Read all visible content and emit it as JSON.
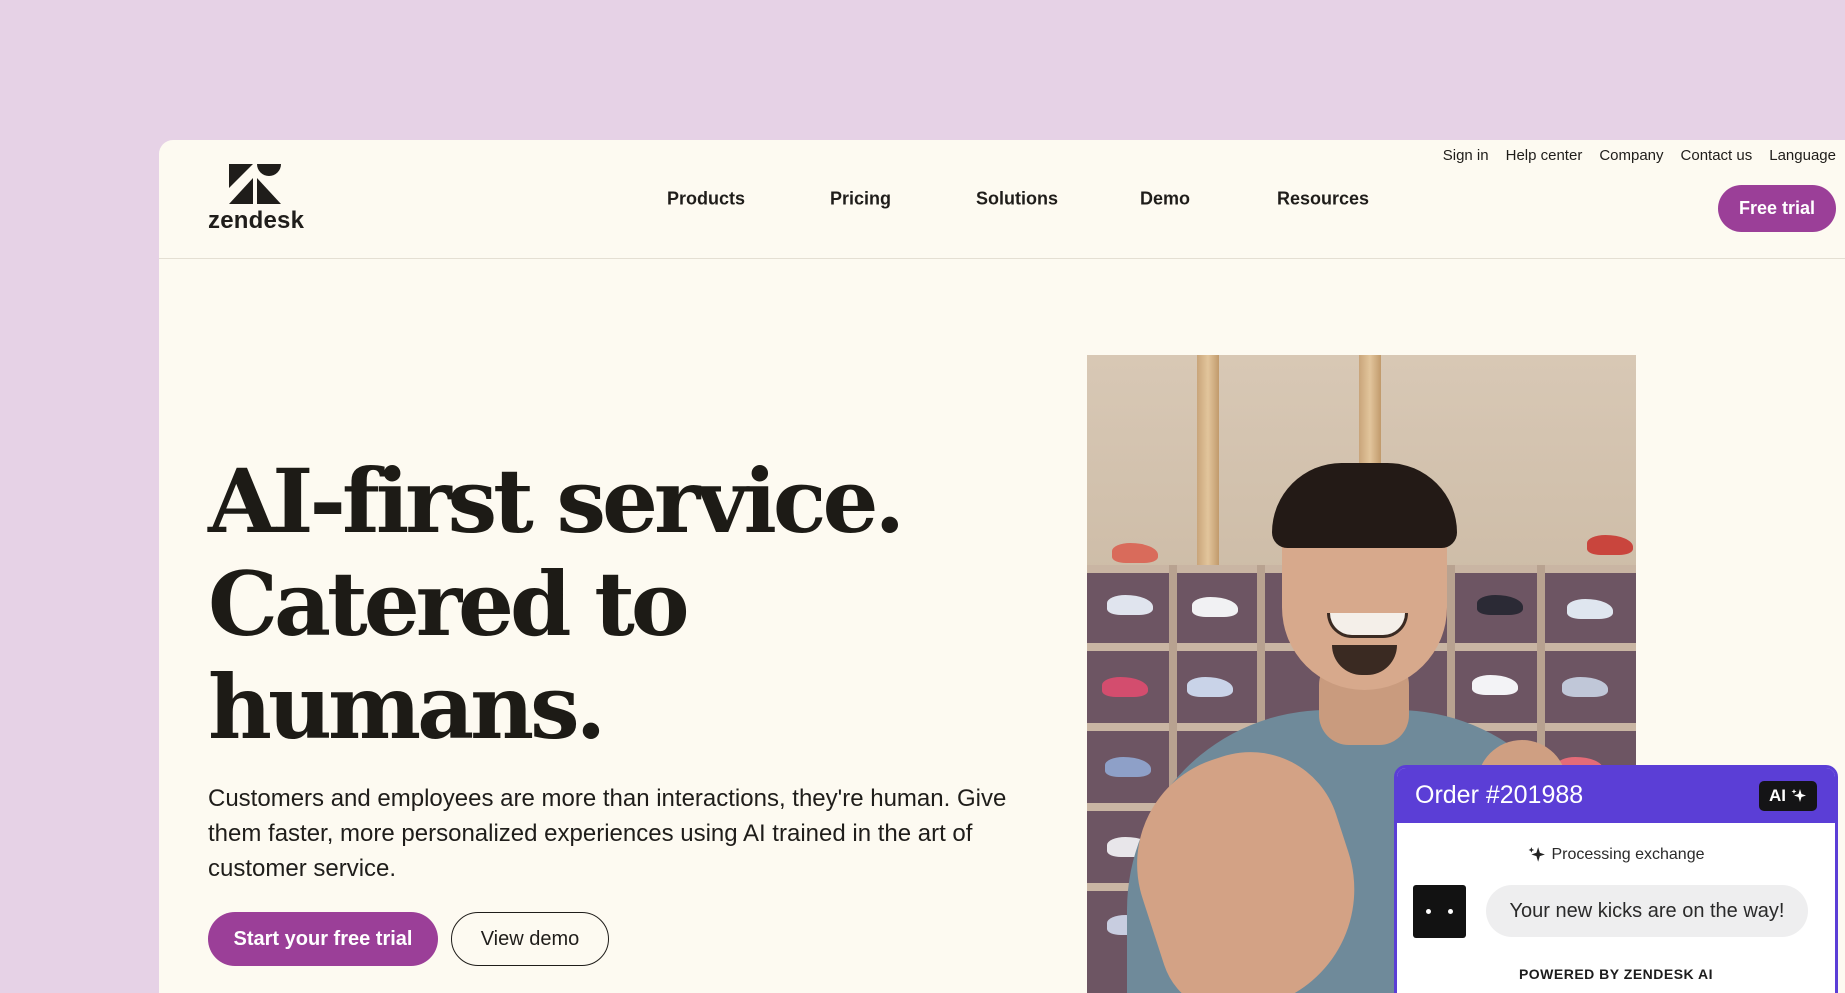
{
  "utility_nav": {
    "sign_in": "Sign in",
    "help_center": "Help center",
    "company": "Company",
    "contact_us": "Contact us",
    "language": "Language"
  },
  "brand": {
    "name": "zendesk"
  },
  "nav": {
    "products": "Products",
    "pricing": "Pricing",
    "solutions": "Solutions",
    "demo": "Demo",
    "resources": "Resources",
    "free_trial": "Free trial"
  },
  "hero": {
    "headline_lines": [
      "AI-first service.",
      "Catered to",
      "humans."
    ],
    "subcopy": "Customers and employees are more than interactions, they're human. Give them faster, more personalized experiences using AI trained in the art of customer service.",
    "cta_primary": "Start your free trial",
    "cta_secondary": "View demo"
  },
  "order_card": {
    "title": "Order #201988",
    "badge": "AI",
    "status": "Processing exchange",
    "message": "Your new kicks are on the way!",
    "footer": "POWERED BY ZENDESK AI"
  },
  "colors": {
    "page_background": "#e6d2e6",
    "window_background": "#fdfaf1",
    "brand_purple": "#9b3f98",
    "card_accent": "#5b3ed6"
  },
  "icons": [
    "zendesk-logo-icon",
    "sparkle-icon",
    "bot-avatar-icon"
  ]
}
